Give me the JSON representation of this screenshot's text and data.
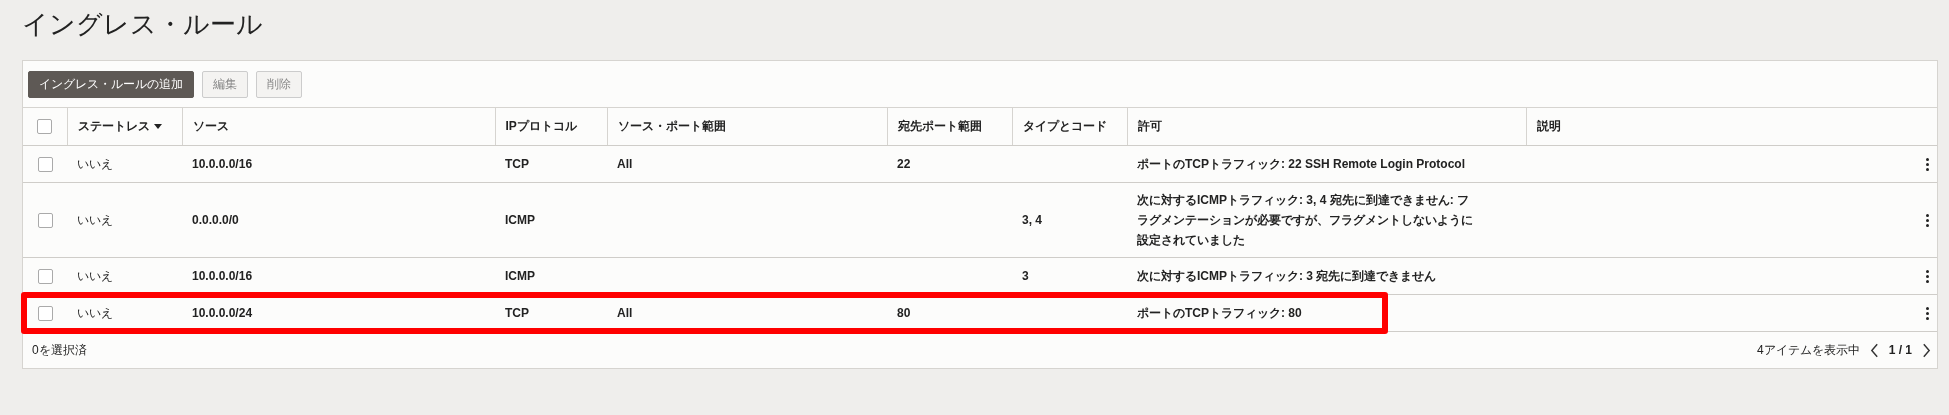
{
  "title": "イングレス・ルール",
  "toolbar": [
    {
      "label": "イングレス・ルールの追加",
      "kind": "primary",
      "disabled": false
    },
    {
      "label": "編集",
      "kind": "secondary",
      "disabled": true
    },
    {
      "label": "削除",
      "kind": "secondary",
      "disabled": true
    }
  ],
  "table": {
    "all_checked": false,
    "columns": [
      {
        "label": "ステートレス",
        "sorted": true
      },
      {
        "label": "ソース",
        "sorted": false
      },
      {
        "label": "IPプロトコル",
        "sorted": false
      },
      {
        "label": "ソース・ポート範囲",
        "sorted": false
      },
      {
        "label": "宛先ポート範囲",
        "sorted": false
      },
      {
        "label": "タイプとコード",
        "sorted": false
      },
      {
        "label": "許可",
        "sorted": false
      },
      {
        "label": "説明",
        "sorted": false
      }
    ],
    "rows": [
      {
        "checked": false,
        "highlighted": false,
        "stateless": "いいえ",
        "source": "10.0.0.0/16",
        "protocol": "TCP",
        "source_port": "All",
        "dest_port": "22",
        "allow": "ポートのTCPトラフィック: 22 SSH Remote Login Protocol"
      },
      {
        "checked": false,
        "highlighted": false,
        "stateless": "いいえ",
        "source": "0.0.0.0/0",
        "protocol": "ICMP",
        "type_code": "3, 4",
        "allow": "次に対するICMPトラフィック: 3, 4 宛先に到達できません: フラグメンテーションが必要ですが、フラグメントしないように設定されていました"
      },
      {
        "checked": false,
        "highlighted": false,
        "stateless": "いいえ",
        "source": "10.0.0.0/16",
        "protocol": "ICMP",
        "type_code": "3",
        "allow": "次に対するICMPトラフィック: 3 宛先に到達できません"
      },
      {
        "checked": false,
        "highlighted": true,
        "stateless": "いいえ",
        "source": "10.0.0.0/24",
        "protocol": "TCP",
        "source_port": "All",
        "dest_port": "80",
        "allow": "ポートのTCPトラフィック: 80"
      }
    ]
  },
  "footer": {
    "selected_count": "0を選択済",
    "items_shown": "4アイテムを表示中",
    "page": "1 / 1"
  }
}
